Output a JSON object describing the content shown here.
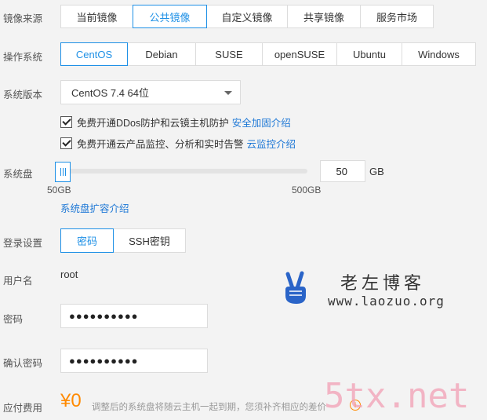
{
  "image_source": {
    "label": "镜像来源",
    "options": [
      "当前镜像",
      "公共镜像",
      "自定义镜像",
      "共享镜像",
      "服务市场"
    ],
    "selected": "公共镜像"
  },
  "os": {
    "label": "操作系统",
    "options": [
      "CentOS",
      "Debian",
      "SUSE",
      "openSUSE",
      "Ubuntu",
      "Windows"
    ],
    "selected": "CentOS"
  },
  "version": {
    "label": "系统版本",
    "value": "CentOS 7.4 64位"
  },
  "checkbox_ddos": {
    "text": "免费开通DDos防护和云镜主机防护",
    "link": "安全加固介绍",
    "checked": true
  },
  "checkbox_monitor": {
    "text": "免费开通云产品监控、分析和实时告警",
    "link": "云监控介绍",
    "checked": true
  },
  "disk": {
    "label": "系统盘",
    "value": "50",
    "unit": "GB",
    "min_label": "50GB",
    "max_label": "500GB",
    "expand_link": "系统盘扩容介绍",
    "slider_level": 0
  },
  "login": {
    "label": "登录设置",
    "options": [
      "密码",
      "SSH密钥"
    ],
    "selected": "密码"
  },
  "username": {
    "label": "用户名",
    "value": "root"
  },
  "password": {
    "label": "密码",
    "value": "●●●●●●●●●●"
  },
  "confirm_password": {
    "label": "确认密码",
    "value": "●●●●●●●●●●"
  },
  "fee": {
    "label": "应付费用",
    "amount": "¥0",
    "note": "调整后的系统盘将随云主机一起到期，您须补齐相应的差价"
  },
  "watermark1": {
    "title": "老左博客",
    "url": "www.laozuo.org"
  },
  "watermark2": {
    "text": "5tx.net"
  },
  "colors": {
    "accent": "#1e90e6",
    "link": "#1e78d6",
    "price": "#ff8a00"
  }
}
